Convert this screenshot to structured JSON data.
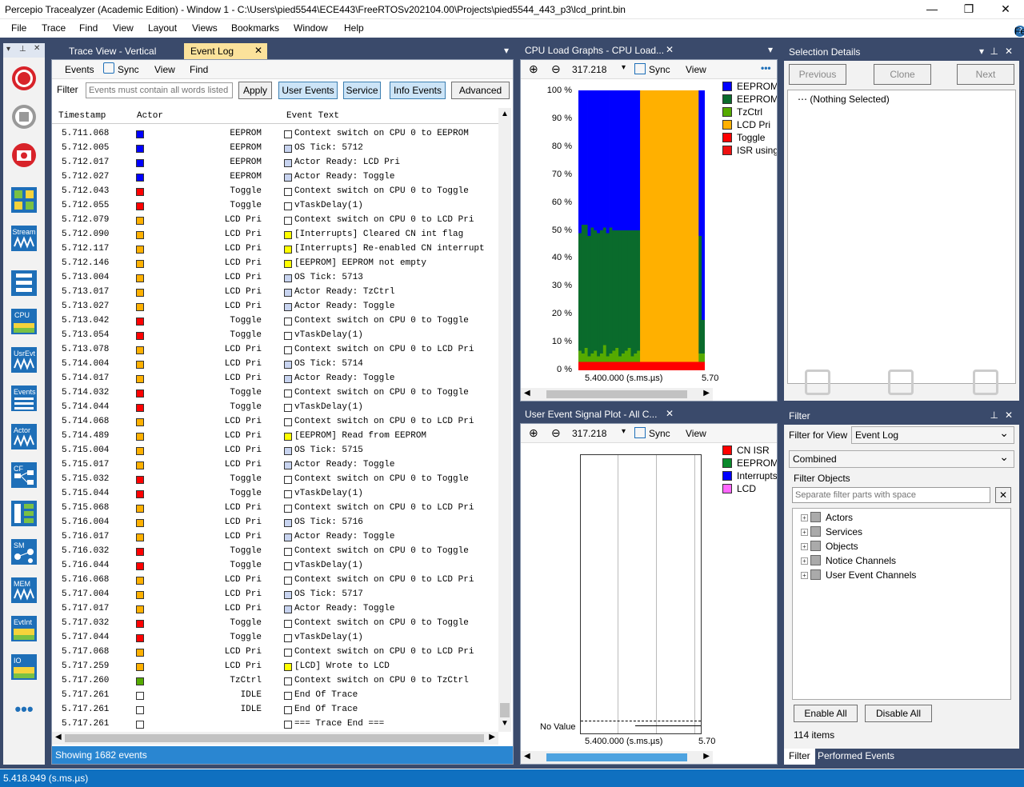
{
  "window": {
    "title": "Percepio Tracealyzer (Academic Edition) - Window 1 - C:\\Users\\pied5544\\ECE443\\FreeRTOSv202104.00\\Projects\\pied5544_443_p3\\lcd_print.bin",
    "minimize": "—",
    "restore": "❐",
    "close": "✕"
  },
  "menu": [
    "File",
    "Trace",
    "Find",
    "View",
    "Layout",
    "Views",
    "Bookmarks",
    "Window",
    "Help"
  ],
  "feedback": "Feedback",
  "left_toolbar": {
    "items": [
      {
        "name": "record-icon",
        "label": ""
      },
      {
        "name": "stop-icon",
        "label": ""
      },
      {
        "name": "snapshot-icon",
        "label": ""
      },
      {
        "name": "trace-view-icon",
        "label": ""
      },
      {
        "name": "stream-icon",
        "label": "Stream"
      },
      {
        "name": "layout-icon",
        "label": ""
      },
      {
        "name": "cpu-icon",
        "label": "CPU"
      },
      {
        "name": "user-event-icon",
        "label": "UsrEvt"
      },
      {
        "name": "events-icon",
        "label": "Events"
      },
      {
        "name": "actor-icon",
        "label": "Actor"
      },
      {
        "name": "cf-icon",
        "label": "CF"
      },
      {
        "name": "dependency-icon",
        "label": ""
      },
      {
        "name": "sm-icon",
        "label": "SM"
      },
      {
        "name": "mem-icon",
        "label": "MEM"
      },
      {
        "name": "evtint-icon",
        "label": "EvtInt"
      },
      {
        "name": "io-icon",
        "label": "IO"
      },
      {
        "name": "more-icon",
        "label": "•••"
      }
    ]
  },
  "event_log": {
    "tabs": [
      "Trace View - Vertical",
      "Event Log"
    ],
    "submenu": [
      "Events",
      "Sync",
      "View",
      "Find"
    ],
    "filter_label": "Filter",
    "filter_placeholder": "Events must contain all words listed",
    "buttons": {
      "apply": "Apply",
      "user_events": "User Events",
      "service": "Service",
      "info_events": "Info Events",
      "advanced": "Advanced"
    },
    "columns": [
      "Timestamp",
      "Actor",
      "Event Text"
    ],
    "rows": [
      {
        "ts": "5.711.068",
        "color": "#0000ff",
        "actor": "EEPROM",
        "ecolor": "#ffffff",
        "text": "Context switch on CPU 0 to EEPROM"
      },
      {
        "ts": "5.712.005",
        "color": "#0000ff",
        "actor": "EEPROM",
        "ecolor": "#c8d4f0",
        "text": "OS Tick: 5712"
      },
      {
        "ts": "5.712.017",
        "color": "#0000ff",
        "actor": "EEPROM",
        "ecolor": "#c8d4f0",
        "text": "Actor Ready: LCD Pri"
      },
      {
        "ts": "5.712.027",
        "color": "#0000ff",
        "actor": "EEPROM",
        "ecolor": "#c8d4f0",
        "text": "Actor Ready: Toggle"
      },
      {
        "ts": "5.712.043",
        "color": "#ff0000",
        "actor": "Toggle",
        "ecolor": "#ffffff",
        "text": "Context switch on CPU 0 to Toggle"
      },
      {
        "ts": "5.712.055",
        "color": "#ff0000",
        "actor": "Toggle",
        "ecolor": "#ffffff",
        "text": "vTaskDelay(1)"
      },
      {
        "ts": "5.712.079",
        "color": "#ffb000",
        "actor": "LCD Pri",
        "ecolor": "#ffffff",
        "text": "Context switch on CPU 0 to LCD Pri"
      },
      {
        "ts": "5.712.090",
        "color": "#ffb000",
        "actor": "LCD Pri",
        "ecolor": "#ffff00",
        "text": "[Interrupts] Cleared CN int flag"
      },
      {
        "ts": "5.712.117",
        "color": "#ffb000",
        "actor": "LCD Pri",
        "ecolor": "#ffff00",
        "text": "[Interrupts] Re-enabled CN interrupt"
      },
      {
        "ts": "5.712.146",
        "color": "#ffb000",
        "actor": "LCD Pri",
        "ecolor": "#ffff00",
        "text": "[EEPROM] EEPROM not empty"
      },
      {
        "ts": "5.713.004",
        "color": "#ffb000",
        "actor": "LCD Pri",
        "ecolor": "#c8d4f0",
        "text": "OS Tick: 5713"
      },
      {
        "ts": "5.713.017",
        "color": "#ffb000",
        "actor": "LCD Pri",
        "ecolor": "#c8d4f0",
        "text": "Actor Ready: TzCtrl"
      },
      {
        "ts": "5.713.027",
        "color": "#ffb000",
        "actor": "LCD Pri",
        "ecolor": "#c8d4f0",
        "text": "Actor Ready: Toggle"
      },
      {
        "ts": "5.713.042",
        "color": "#ff0000",
        "actor": "Toggle",
        "ecolor": "#ffffff",
        "text": "Context switch on CPU 0 to Toggle"
      },
      {
        "ts": "5.713.054",
        "color": "#ff0000",
        "actor": "Toggle",
        "ecolor": "#ffffff",
        "text": "vTaskDelay(1)"
      },
      {
        "ts": "5.713.078",
        "color": "#ffb000",
        "actor": "LCD Pri",
        "ecolor": "#ffffff",
        "text": "Context switch on CPU 0 to LCD Pri"
      },
      {
        "ts": "5.714.004",
        "color": "#ffb000",
        "actor": "LCD Pri",
        "ecolor": "#c8d4f0",
        "text": "OS Tick: 5714"
      },
      {
        "ts": "5.714.017",
        "color": "#ffb000",
        "actor": "LCD Pri",
        "ecolor": "#c8d4f0",
        "text": "Actor Ready: Toggle"
      },
      {
        "ts": "5.714.032",
        "color": "#ff0000",
        "actor": "Toggle",
        "ecolor": "#ffffff",
        "text": "Context switch on CPU 0 to Toggle"
      },
      {
        "ts": "5.714.044",
        "color": "#ff0000",
        "actor": "Toggle",
        "ecolor": "#ffffff",
        "text": "vTaskDelay(1)"
      },
      {
        "ts": "5.714.068",
        "color": "#ffb000",
        "actor": "LCD Pri",
        "ecolor": "#ffffff",
        "text": "Context switch on CPU 0 to LCD Pri"
      },
      {
        "ts": "5.714.489",
        "color": "#ffb000",
        "actor": "LCD Pri",
        "ecolor": "#ffff00",
        "text": "[EEPROM] Read from EEPROM"
      },
      {
        "ts": "5.715.004",
        "color": "#ffb000",
        "actor": "LCD Pri",
        "ecolor": "#c8d4f0",
        "text": "OS Tick: 5715"
      },
      {
        "ts": "5.715.017",
        "color": "#ffb000",
        "actor": "LCD Pri",
        "ecolor": "#c8d4f0",
        "text": "Actor Ready: Toggle"
      },
      {
        "ts": "5.715.032",
        "color": "#ff0000",
        "actor": "Toggle",
        "ecolor": "#ffffff",
        "text": "Context switch on CPU 0 to Toggle"
      },
      {
        "ts": "5.715.044",
        "color": "#ff0000",
        "actor": "Toggle",
        "ecolor": "#ffffff",
        "text": "vTaskDelay(1)"
      },
      {
        "ts": "5.715.068",
        "color": "#ffb000",
        "actor": "LCD Pri",
        "ecolor": "#ffffff",
        "text": "Context switch on CPU 0 to LCD Pri"
      },
      {
        "ts": "5.716.004",
        "color": "#ffb000",
        "actor": "LCD Pri",
        "ecolor": "#c8d4f0",
        "text": "OS Tick: 5716"
      },
      {
        "ts": "5.716.017",
        "color": "#ffb000",
        "actor": "LCD Pri",
        "ecolor": "#c8d4f0",
        "text": "Actor Ready: Toggle"
      },
      {
        "ts": "5.716.032",
        "color": "#ff0000",
        "actor": "Toggle",
        "ecolor": "#ffffff",
        "text": "Context switch on CPU 0 to Toggle"
      },
      {
        "ts": "5.716.044",
        "color": "#ff0000",
        "actor": "Toggle",
        "ecolor": "#ffffff",
        "text": "vTaskDelay(1)"
      },
      {
        "ts": "5.716.068",
        "color": "#ffb000",
        "actor": "LCD Pri",
        "ecolor": "#ffffff",
        "text": "Context switch on CPU 0 to LCD Pri"
      },
      {
        "ts": "5.717.004",
        "color": "#ffb000",
        "actor": "LCD Pri",
        "ecolor": "#c8d4f0",
        "text": "OS Tick: 5717"
      },
      {
        "ts": "5.717.017",
        "color": "#ffb000",
        "actor": "LCD Pri",
        "ecolor": "#c8d4f0",
        "text": "Actor Ready: Toggle"
      },
      {
        "ts": "5.717.032",
        "color": "#ff0000",
        "actor": "Toggle",
        "ecolor": "#ffffff",
        "text": "Context switch on CPU 0 to Toggle"
      },
      {
        "ts": "5.717.044",
        "color": "#ff0000",
        "actor": "Toggle",
        "ecolor": "#ffffff",
        "text": "vTaskDelay(1)"
      },
      {
        "ts": "5.717.068",
        "color": "#ffb000",
        "actor": "LCD Pri",
        "ecolor": "#ffffff",
        "text": "Context switch on CPU 0 to LCD Pri"
      },
      {
        "ts": "5.717.259",
        "color": "#ffb000",
        "actor": "LCD Pri",
        "ecolor": "#ffff00",
        "text": "[LCD] Wrote to LCD"
      },
      {
        "ts": "5.717.260",
        "color": "#55aa00",
        "actor": "TzCtrl",
        "ecolor": "#ffffff",
        "text": "Context switch on CPU 0 to TzCtrl"
      },
      {
        "ts": "5.717.261",
        "color": "#ffffff",
        "actor": "IDLE",
        "ecolor": "#ffffff",
        "text": "End Of Trace"
      },
      {
        "ts": "5.717.261",
        "color": "#ffffff",
        "actor": "IDLE",
        "ecolor": "#ffffff",
        "text": "End Of Trace"
      },
      {
        "ts": "5.717.261",
        "color": "#ffffff",
        "actor": "",
        "ecolor": "#ffffff",
        "text": "=== Trace End ==="
      }
    ],
    "status": "Showing 1682 events"
  },
  "cpu_load": {
    "title": "CPU Load Graphs - CPU Load...",
    "zoom": "317.218",
    "sync": "Sync",
    "view": "View",
    "more": "•••",
    "yticks": [
      "100 %",
      "90 %",
      "80 %",
      "70 %",
      "60 %",
      "50 %",
      "40 %",
      "30 %",
      "20 %",
      "10 %",
      "0 %"
    ],
    "xtick": "5.400.000 (s.ms.µs)",
    "xtick2": "5.70",
    "legend": [
      {
        "label": "EEPROM",
        "color": "#0000ff"
      },
      {
        "label": "EEPROM",
        "color": "#0a6b2c"
      },
      {
        "label": "TzCtrl",
        "color": "#55aa00"
      },
      {
        "label": "LCD Pri",
        "color": "#ffb000"
      },
      {
        "label": "Toggle",
        "color": "#ff0000"
      },
      {
        "label": "ISR using S",
        "color": "#ee1111"
      }
    ]
  },
  "chart_data": {
    "type": "area",
    "title": "CPU Load Graphs - CPU Load...",
    "xlabel": "5.400.000 (s.ms.µs)",
    "ylabel": "",
    "ylim": [
      0,
      100
    ],
    "series": [
      {
        "name": "Toggle",
        "color": "#ff0000",
        "values": [
          3,
          3,
          3,
          3,
          3,
          3,
          3,
          3,
          3,
          3,
          3,
          3,
          3,
          3,
          3,
          3,
          3,
          3,
          3,
          3,
          3,
          3,
          3,
          3,
          3,
          3,
          3,
          3,
          3,
          3,
          3,
          3,
          3,
          3,
          3,
          3,
          3,
          3,
          3,
          3,
          3
        ]
      },
      {
        "name": "TzCtrl",
        "color": "#55aa00",
        "values": [
          4,
          3,
          5,
          2,
          3,
          4,
          2,
          3,
          6,
          2,
          3,
          4,
          5,
          2,
          3,
          4,
          5,
          2,
          3,
          4,
          0,
          0,
          0,
          0,
          0,
          0,
          0,
          0,
          0,
          0,
          0,
          0,
          0,
          0,
          0,
          0,
          0,
          0,
          0,
          3,
          3
        ]
      },
      {
        "name": "EEPROM",
        "color": "#0a6b2c",
        "values": [
          42,
          46,
          44,
          43,
          45,
          43,
          44,
          44,
          42,
          44,
          45,
          43,
          42,
          45,
          44,
          43,
          42,
          45,
          44,
          43,
          0,
          0,
          0,
          0,
          0,
          0,
          0,
          0,
          0,
          0,
          0,
          0,
          0,
          0,
          0,
          0,
          0,
          0,
          0,
          42,
          12
        ]
      },
      {
        "name": "LCD Pri",
        "color": "#ffb000",
        "values": [
          0,
          0,
          0,
          0,
          0,
          0,
          0,
          0,
          0,
          0,
          0,
          0,
          0,
          0,
          0,
          0,
          0,
          0,
          0,
          0,
          97,
          97,
          97,
          97,
          97,
          97,
          97,
          97,
          97,
          97,
          97,
          97,
          97,
          97,
          97,
          97,
          97,
          97,
          97,
          0,
          0
        ]
      },
      {
        "name": "EEPROM",
        "color": "#0000ff",
        "values": [
          51,
          48,
          48,
          52,
          49,
          50,
          51,
          50,
          49,
          51,
          49,
          50,
          50,
          50,
          50,
          50,
          50,
          50,
          50,
          50,
          0,
          0,
          0,
          0,
          0,
          0,
          0,
          0,
          0,
          0,
          0,
          0,
          0,
          0,
          0,
          0,
          0,
          0,
          0,
          52,
          82
        ]
      }
    ]
  },
  "user_event_plot": {
    "title": "User Event Signal Plot - All C...",
    "zoom": "317.218",
    "sync": "Sync",
    "view": "View",
    "no_value": "No Value",
    "xtick": "5.400.000 (s.ms.µs)",
    "xtick2": "5.70",
    "legend": [
      {
        "label": "CN ISR",
        "color": "#ff0000"
      },
      {
        "label": "EEPROM",
        "color": "#0a8a2c"
      },
      {
        "label": "Interrupts",
        "color": "#0000ff"
      },
      {
        "label": "LCD",
        "color": "#ff66ff"
      }
    ]
  },
  "selection_details": {
    "title": "Selection Details",
    "prev": "Previous",
    "clone": "Clone",
    "next": "Next",
    "nothing": "(Nothing Selected)"
  },
  "filter_panel": {
    "title": "Filter",
    "filter_for_view_label": "Filter for View",
    "filter_for_view": "Event Log",
    "mode": "Combined",
    "objects_label": "Filter Objects",
    "search_placeholder": "Separate filter parts with space",
    "clear": "✕",
    "tree": [
      "Actors",
      "Services",
      "Objects",
      "Notice Channels",
      "User Event Channels"
    ],
    "enable_all": "Enable All",
    "disable_all": "Disable All",
    "count": "114 items",
    "tabs": [
      "Filter",
      "Performed Events"
    ]
  },
  "status_bar": "5.418.949 (s.ms.µs)"
}
